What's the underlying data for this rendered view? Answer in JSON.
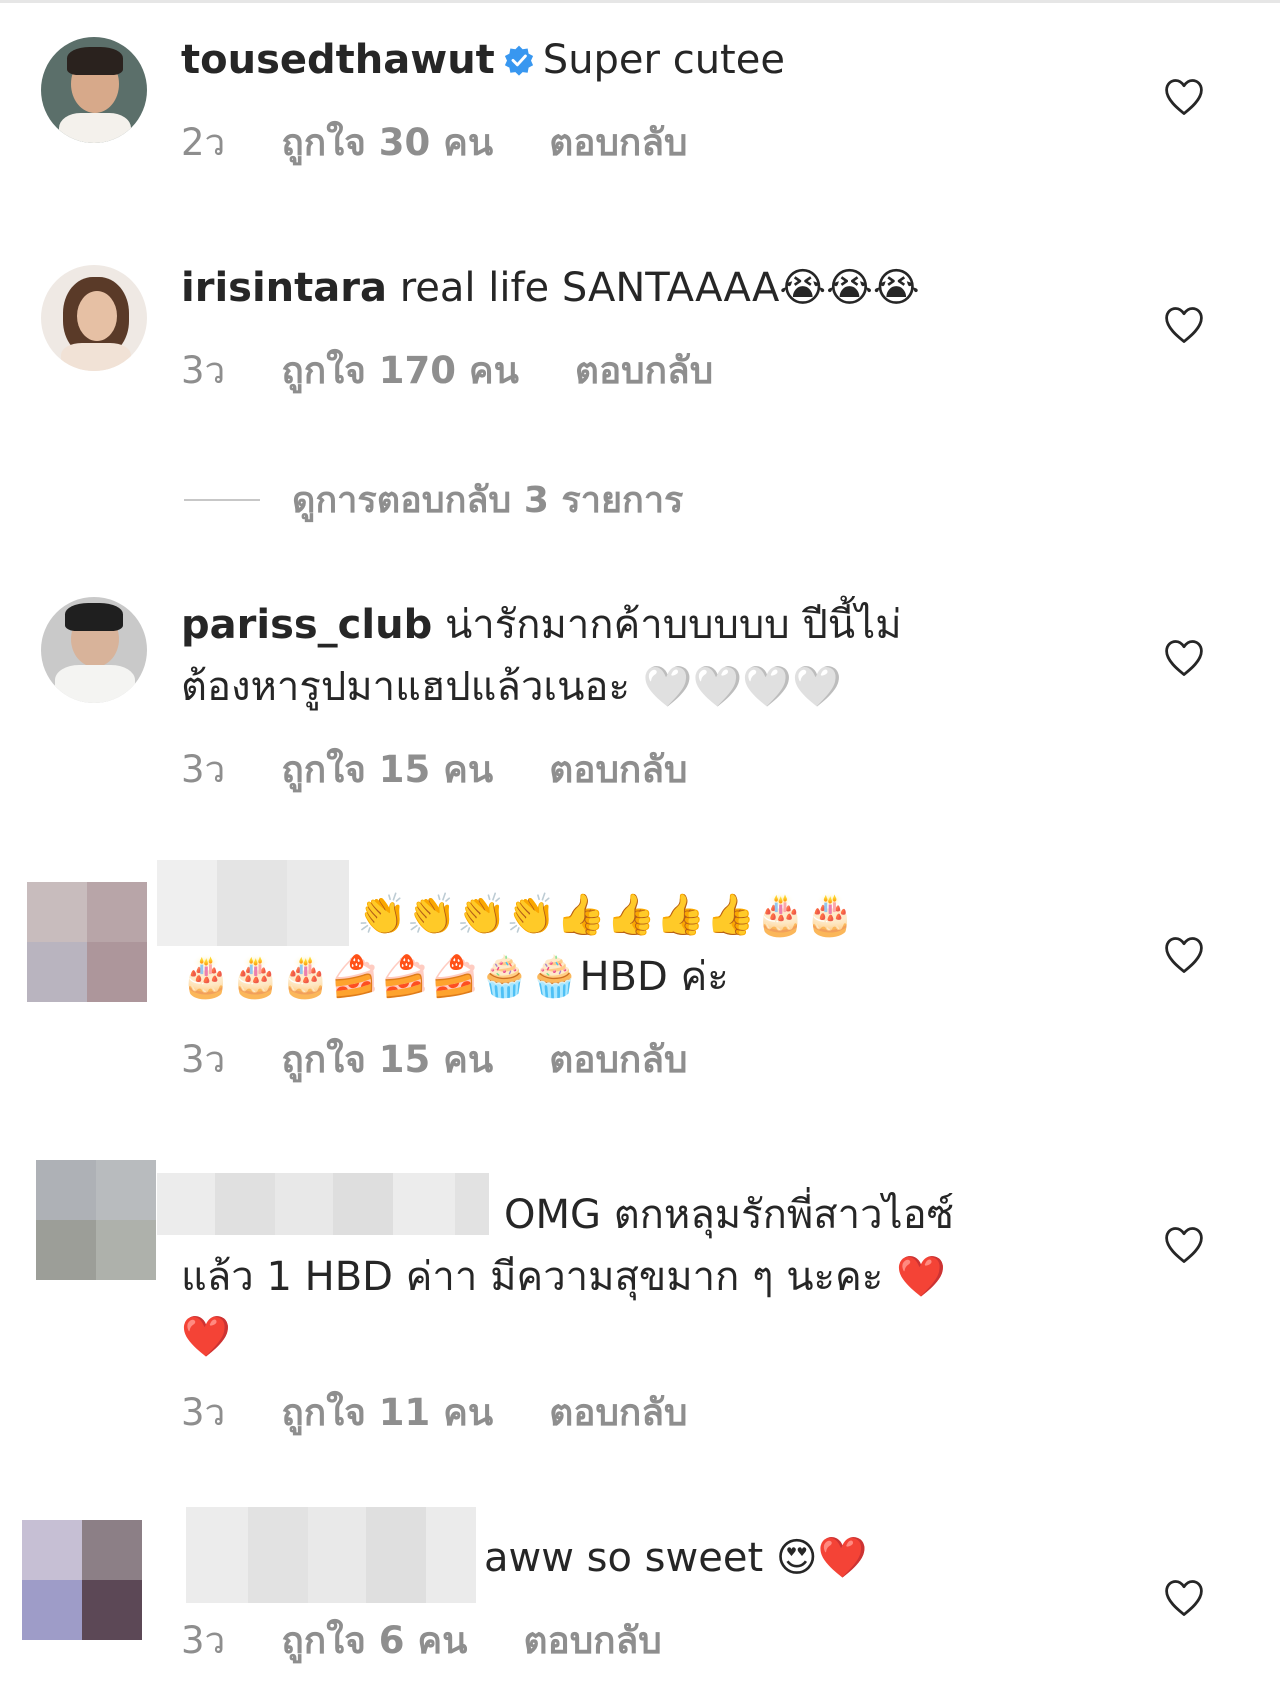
{
  "comments": [
    {
      "username": "tousedthawut",
      "verified": true,
      "text": "Super cutee",
      "time": "2ว",
      "likes": "ถูกใจ 30 คน",
      "reply": "ตอบกลับ"
    },
    {
      "username": "irisintara",
      "verified": false,
      "text": "real life SANTAAAA😭😭😭",
      "time": "3ว",
      "likes": "ถูกใจ 170 คน",
      "reply": "ตอบกลับ",
      "view_replies": "ดูการตอบกลับ 3 รายการ"
    },
    {
      "username": "pariss_club",
      "verified": false,
      "text_line1": "น่ารักมากค้าบบบบบ ปีนี้ไม่",
      "text_line2": "ต้องหารูปมาแฮปแล้วเนอะ 🤍🤍🤍🤍",
      "time": "3ว",
      "likes": "ถูกใจ 15 คน",
      "reply": "ตอบกลับ"
    },
    {
      "username": "",
      "text_line1": "👏👏👏👏👍👍👍👍🎂🎂",
      "text_line2": "🎂🎂🎂🍰🍰🍰🧁🧁HBD ค่ะ",
      "time": "3ว",
      "likes": "ถูกใจ 15 คน",
      "reply": "ตอบกลับ"
    },
    {
      "username": "",
      "text_line1": "OMG  ตกหลุมรักพี่สาวไอซ์",
      "text_line2": "แล้ว 1 HBD ค่าา มีความสุขมาก ๆ นะคะ ❤️",
      "text_line3": "❤️",
      "time": "3ว",
      "likes": "ถูกใจ 11 คน",
      "reply": "ตอบกลับ"
    },
    {
      "username": "",
      "text_line1": "aww so sweet 😍❤️",
      "time": "3ว",
      "likes": "ถูกใจ 6 คน",
      "reply": "ตอบกลับ"
    }
  ],
  "colors": {
    "text": "#262626",
    "meta": "#8e8e8e",
    "verified": "#3897f0",
    "heart_stroke": "#262626"
  },
  "icons": {
    "like": "heart-outline-icon",
    "verified": "verified-badge-icon"
  }
}
